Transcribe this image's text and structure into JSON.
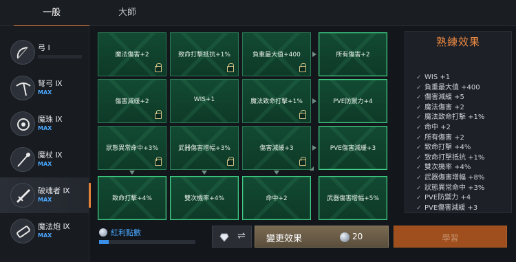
{
  "tabs": [
    {
      "label": "一般"
    },
    {
      "label": "大師"
    }
  ],
  "weapons": [
    {
      "name": "弓 Ⅰ",
      "max": "",
      "icon": "bow-icon",
      "progress": 0
    },
    {
      "name": "弩弓 Ⅸ",
      "max": "MAX",
      "icon": "crossbow-icon"
    },
    {
      "name": "魔珠 Ⅸ",
      "max": "MAX",
      "icon": "orb-icon"
    },
    {
      "name": "魔杖 Ⅸ",
      "max": "MAX",
      "icon": "wand-icon"
    },
    {
      "name": "破魂者 Ⅸ",
      "max": "MAX",
      "icon": "soul-breaker-icon",
      "active": true
    },
    {
      "name": "魔法炮 Ⅸ",
      "max": "MAX",
      "icon": "magic-cannon-icon"
    }
  ],
  "grid": [
    [
      {
        "label": "魔法傷害+2",
        "locked": true
      },
      {
        "label": "致命打擊抵抗+1%",
        "locked": true
      },
      {
        "label": "負重最大值+400",
        "locked": true
      },
      {
        "label": "所有傷害+2",
        "locked": false
      }
    ],
    [
      {
        "label": "傷害減緩+2",
        "locked": true
      },
      {
        "label": "WIS+1",
        "locked": false
      },
      {
        "label": "魔法致命打擊+1%",
        "locked": true
      },
      {
        "label": "PVE防禦力+4",
        "locked": false
      }
    ],
    [
      {
        "label": "狀態異常命中+3%",
        "locked": true
      },
      {
        "label": "武器傷害增幅+3%",
        "locked": true
      },
      {
        "label": "傷害減緩+3",
        "locked": true
      },
      {
        "label": "PVE傷害減緩+3",
        "locked": false
      }
    ],
    [
      {
        "label": "致命打擊+4%",
        "locked": false
      },
      {
        "label": "雙次機率+4%",
        "locked": false
      },
      {
        "label": "命中+2",
        "locked": false
      },
      {
        "label": "武器傷害增幅+5%",
        "locked": false
      }
    ]
  ],
  "panel": {
    "title": "熟練效果",
    "effects": [
      "WIS +1",
      "負重最大值 +400",
      "傷害減緩 +5",
      "魔法傷害 +2",
      "魔法致命打擊 +1%",
      "命中 +2",
      "所有傷害 +2",
      "致命打擊 +4%",
      "致命打擊抵抗 +1%",
      "雙次機率 +4%",
      "武器傷害增幅 +8%",
      "狀態異常命中 +3%",
      "PVE防禦力 +4",
      "PVE傷害減緩 +3"
    ]
  },
  "bottom": {
    "bonus_label": "紅利點數",
    "bonus_progress": 0.1,
    "swap_symbol": "⇌",
    "change_label": "變更效果",
    "change_cost": "20",
    "learn_label": "學習"
  },
  "colors": {
    "accent": "#e8843a",
    "max": "#4aa8ff",
    "cell": "#124a33",
    "cell_border": "#3fcf86"
  }
}
